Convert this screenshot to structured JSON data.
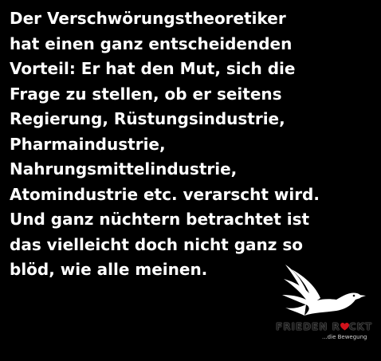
{
  "quote": {
    "lines": [
      "Der Verschwörungstheoretiker",
      "hat einen ganz entscheidenden",
      "Vorteil: Er hat den Mut, sich die",
      "Frage zu stellen, ob er seitens",
      "Regierung, Rüstungsindustrie,",
      "Pharmaindustrie,",
      "Nahrungsmittelindustrie,",
      "Atomindustrie etc. verarscht wird.",
      "Und ganz nüchtern betrachtet ist",
      "das vielleicht doch nicht ganz so",
      "blöd, wie alle meinen."
    ]
  },
  "logo": {
    "brand_before": "FRIEDEN R",
    "brand_after": "CKT",
    "tagline": "...die Bewegung",
    "icon": "dove-icon",
    "accent_icon": "heart-icon",
    "colors": {
      "background": "#000000",
      "text": "#ffffff",
      "heart": "#d0121b"
    }
  }
}
